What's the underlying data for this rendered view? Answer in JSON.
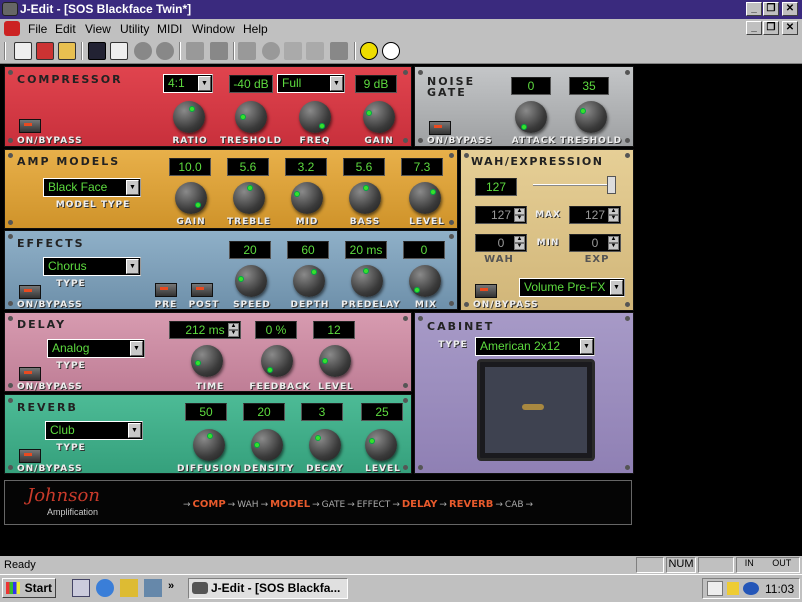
{
  "window": {
    "title": "J-Edit - [SOS Blackface Twin*]",
    "min": "_",
    "restore": "❐",
    "close": "✕"
  },
  "menu": [
    "File",
    "Edit",
    "View",
    "Utility",
    "MIDI",
    "Window",
    "Help"
  ],
  "compressor": {
    "title": "COMPRESSOR",
    "ratio": "4:1",
    "threshold": "-40 dB",
    "freq": "Full",
    "gain": "9 dB",
    "labels": [
      "RATIO",
      "TRESHOLD",
      "FREQ",
      "GAIN"
    ],
    "bypass": "ON/BYPASS"
  },
  "noise_gate": {
    "title1": "NOISE",
    "title2": "GATE",
    "attack": "0",
    "threshold": "35",
    "labels": [
      "ATTACK",
      "TRESHOLD"
    ],
    "bypass": "ON/BYPASS"
  },
  "amp": {
    "title": "AMP MODELS",
    "model": "Black Face",
    "model_label": "MODEL TYPE",
    "values": [
      "10.0",
      "5.6",
      "3.2",
      "5.6",
      "7.3"
    ],
    "labels": [
      "GAIN",
      "TREBLE",
      "MID",
      "BASS",
      "LEVEL"
    ]
  },
  "wah": {
    "title": "WAH/EXPRESSION",
    "value": "127",
    "slider_fraction": 1.0,
    "wah_max": "127",
    "exp_max": "127",
    "wah_min": "0",
    "exp_min": "0",
    "max_label": "MAX",
    "min_label": "MIN",
    "wah_label": "WAH",
    "exp_label": "EXP",
    "mode": "Volume Pre-FX",
    "bypass": "ON/BYPASS"
  },
  "effects": {
    "title": "EFFECTS",
    "type": "Chorus",
    "type_label": "TYPE",
    "values": [
      "20",
      "60",
      "20 ms",
      "0"
    ],
    "labels": [
      "SPEED",
      "DEPTH",
      "PREDELAY",
      "MIX"
    ],
    "pre": "PRE",
    "post": "POST",
    "bypass": "ON/BYPASS"
  },
  "delay": {
    "title": "DELAY",
    "type": "Analog",
    "type_label": "TYPE",
    "values": [
      "212 ms",
      "0 %",
      "12"
    ],
    "labels": [
      "TIME",
      "FEEDBACK",
      "LEVEL"
    ],
    "bypass": "ON/BYPASS"
  },
  "cabinet": {
    "title": "CABINET",
    "type_label": "TYPE",
    "type": "American 2x12"
  },
  "reverb": {
    "title": "REVERB",
    "type": "Club",
    "type_label": "TYPE",
    "values": [
      "50",
      "20",
      "3",
      "25"
    ],
    "labels": [
      "DIFFUSION",
      "DENSITY",
      "DECAY",
      "LEVEL"
    ],
    "bypass": "ON/BYPASS"
  },
  "brand": {
    "logo": "Johnson",
    "sub": "Amplification"
  },
  "chain": [
    {
      "t": "COMP",
      "on": true
    },
    {
      "t": "WAH",
      "on": false
    },
    {
      "t": "MODEL",
      "on": true
    },
    {
      "t": "GATE",
      "on": false
    },
    {
      "t": "EFFECT",
      "on": false
    },
    {
      "t": "DELAY",
      "on": true
    },
    {
      "t": "REVERB",
      "on": true
    },
    {
      "t": "CAB",
      "on": false
    }
  ],
  "status": {
    "text": "Ready",
    "num": "NUM",
    "in": "IN",
    "out": "OUT"
  },
  "taskbar": {
    "start": "Start",
    "task": "J-Edit - [SOS Blackfa...",
    "clock": "11:03",
    "chevron": "»"
  }
}
